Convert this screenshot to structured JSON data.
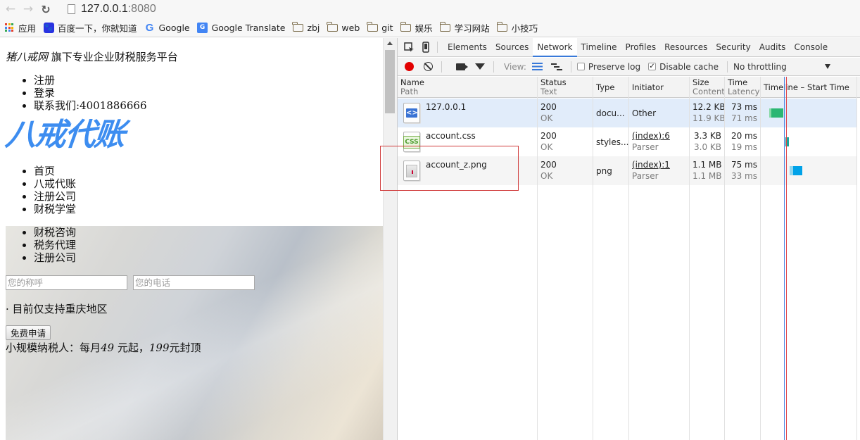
{
  "browser": {
    "url_host": "127.0.0.1",
    "url_port": ":8080",
    "bookmarks": [
      {
        "label": "应用",
        "icon": "apps-grid-icon"
      },
      {
        "label": "百度一下，你就知道",
        "icon": "baidu-paw-icon"
      },
      {
        "label": "Google",
        "icon": "google-icon"
      },
      {
        "label": "Google Translate",
        "icon": "google-translate-icon"
      },
      {
        "label": "zbj",
        "icon": "folder-icon"
      },
      {
        "label": "web",
        "icon": "folder-icon"
      },
      {
        "label": "git",
        "icon": "folder-icon"
      },
      {
        "label": "娱乐",
        "icon": "folder-icon"
      },
      {
        "label": "学习网站",
        "icon": "folder-icon"
      },
      {
        "label": "小技巧",
        "icon": "folder-icon"
      }
    ]
  },
  "page": {
    "slogan_brand": "猪八戒网",
    "slogan_rest": " 旗下专业企业财税服务平台",
    "top_links": [
      "注册",
      "登录",
      "联系我们:4001886666"
    ],
    "logo_text": "八戒代账",
    "logo_color": "#3d8df0",
    "main_nav": [
      "首页",
      "八戒代账",
      "注册公司",
      "财税学堂"
    ],
    "banner_menu": [
      "财税咨询",
      "税务代理",
      "注册公司"
    ],
    "name_placeholder": "您的称呼",
    "phone_placeholder": "您的电话",
    "notice": "· 目前仅支持重庆地区",
    "apply_button": "免费申请",
    "price_prefix": "小规模纳税人：每月",
    "price_monthly": "49",
    "price_mid": " 元起，",
    "price_cap": "199",
    "price_suffix": "元封顶"
  },
  "devtools": {
    "tabs": [
      "Elements",
      "Sources",
      "Network",
      "Timeline",
      "Profiles",
      "Resources",
      "Security",
      "Audits",
      "Console"
    ],
    "active_tab": "Network",
    "toolbar": {
      "view_label": "View:",
      "preserve_log": "Preserve log",
      "preserve_log_checked": false,
      "disable_cache": "Disable cache",
      "disable_cache_checked": true,
      "throttling": "No throttling"
    },
    "columns": [
      {
        "top": "Name",
        "sub": "Path"
      },
      {
        "top": "Status",
        "sub": "Text"
      },
      {
        "top": "Type",
        "sub": ""
      },
      {
        "top": "Initiator",
        "sub": ""
      },
      {
        "top": "Size",
        "sub": "Content"
      },
      {
        "top": "Time",
        "sub": "Latency"
      },
      {
        "top": "Timeline – Start Time",
        "sub": ""
      }
    ],
    "requests": [
      {
        "name": "127.0.0.1",
        "status": "200",
        "status_text": "OK",
        "type": "docu...",
        "initiator": "Other",
        "initiator_sub": "",
        "size": "12.2 KB",
        "content": "11.9 KB",
        "time": "73 ms",
        "latency": "71 ms",
        "icon": "document-icon"
      },
      {
        "name": "account.css",
        "status": "200",
        "status_text": "OK",
        "type": "styles...",
        "initiator": "(index):6",
        "initiator_sub": "Parser",
        "size": "3.3 KB",
        "content": "3.0 KB",
        "time": "20 ms",
        "latency": "19 ms",
        "icon": "css-file-icon"
      },
      {
        "name": "account_z.png",
        "status": "200",
        "status_text": "OK",
        "type": "png",
        "initiator": "(index):1",
        "initiator_sub": "Parser",
        "size": "1.1 MB",
        "content": "1.1 MB",
        "time": "75 ms",
        "latency": "33 ms",
        "icon": "image-file-icon"
      }
    ],
    "colors": {
      "accent": "#3879d9",
      "selected_row": "#e1ecfa",
      "record": "#e20000",
      "highlight_box": "#d03b3b",
      "bar_waiting": "#2bb673",
      "bar_download": "#00a2e8"
    }
  }
}
